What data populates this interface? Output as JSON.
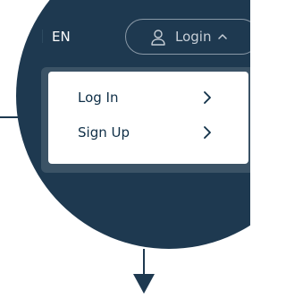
{
  "header": {
    "language_label": "EN",
    "login_button_label": "Login",
    "user_icon": "user-icon",
    "caret_icon": "chevron-up-icon"
  },
  "dropdown": {
    "items": [
      {
        "label": "Log In",
        "icon": "chevron-right-icon"
      },
      {
        "label": "Sign Up",
        "icon": "chevron-right-icon"
      }
    ]
  },
  "colors": {
    "dark_navy": "#1e3950",
    "menu_text": "#0f2f47",
    "white": "#ffffff",
    "border_gray": "#8a99a7"
  }
}
